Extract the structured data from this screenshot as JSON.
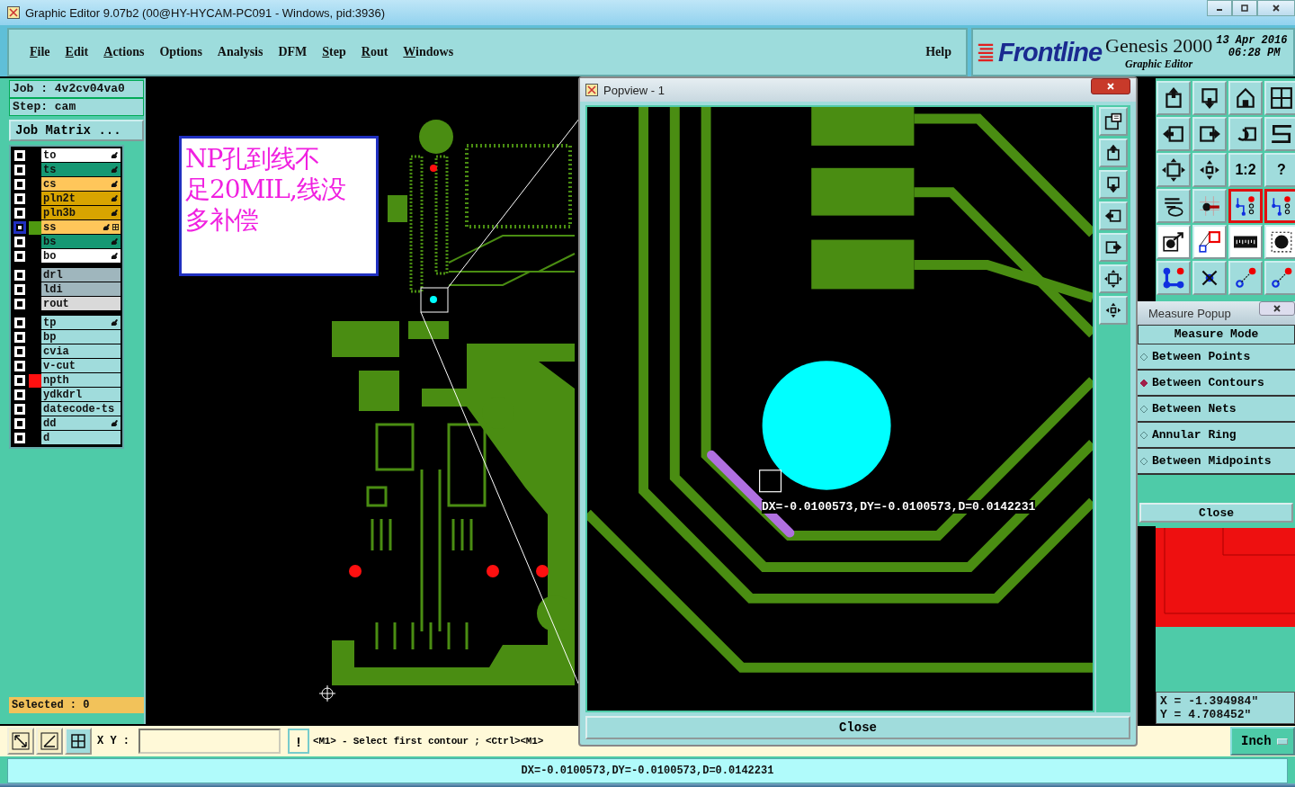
{
  "window": {
    "title": "Graphic Editor 9.07b2 (00@HY-HYCAM-PC091 - Windows, pid:3936)"
  },
  "menu": [
    {
      "label": "File",
      "mnemonic": true
    },
    {
      "label": "Edit",
      "mnemonic": true
    },
    {
      "label": "Actions",
      "mnemonic": true
    },
    {
      "label": "Options",
      "mnemonic": false
    },
    {
      "label": "Analysis",
      "mnemonic": false
    },
    {
      "label": "DFM",
      "mnemonic": false
    },
    {
      "label": "Step",
      "mnemonic": true
    },
    {
      "label": "Rout",
      "mnemonic": true
    },
    {
      "label": "Windows",
      "mnemonic": true
    }
  ],
  "help": "Help",
  "brand": {
    "logo": "Frontline",
    "product": "Genesis 2000",
    "subtitle": "Graphic Editor",
    "date": "13 Apr 2016",
    "time": "06:28 PM"
  },
  "job": "Job : 4v2cv04va0",
  "step": "Step: cam",
  "job_matrix": "Job Matrix ...",
  "layer_groups": [
    [
      {
        "name": "to",
        "kind": "paste",
        "affected": true,
        "selected": false,
        "attributes": false
      },
      {
        "name": "ts",
        "kind": "mask",
        "affected": true,
        "selected": false,
        "attributes": false
      },
      {
        "name": "cs",
        "kind": "signal",
        "affected": true,
        "selected": false,
        "attributes": false
      },
      {
        "name": "pln2t",
        "kind": "plane",
        "affected": true,
        "selected": false,
        "attributes": false
      },
      {
        "name": "pln3b",
        "kind": "plane",
        "affected": true,
        "selected": false,
        "attributes": false
      },
      {
        "name": "ss",
        "kind": "signal",
        "affected": true,
        "selected": true,
        "attributes": true,
        "color": "#4f9a10"
      },
      {
        "name": "bs",
        "kind": "mask",
        "affected": true,
        "selected": false,
        "attributes": false
      },
      {
        "name": "bo",
        "kind": "paste",
        "affected": true,
        "selected": false,
        "attributes": false
      }
    ],
    [
      {
        "name": "drl",
        "kind": "drill",
        "affected": false,
        "selected": false,
        "attributes": false
      },
      {
        "name": "ldi",
        "kind": "drill",
        "affected": false,
        "selected": false,
        "attributes": false
      },
      {
        "name": "rout",
        "kind": "rout",
        "affected": false,
        "selected": false,
        "attributes": false
      }
    ],
    [
      {
        "name": "tp",
        "kind": "document",
        "affected": true,
        "selected": false,
        "attributes": false
      },
      {
        "name": "bp",
        "kind": "document",
        "affected": false,
        "selected": false,
        "attributes": false
      },
      {
        "name": "cvia",
        "kind": "document",
        "affected": false,
        "selected": false,
        "attributes": false
      },
      {
        "name": "v-cut",
        "kind": "document",
        "affected": false,
        "selected": false,
        "attributes": false
      },
      {
        "name": "npth",
        "kind": "document",
        "affected": false,
        "selected": false,
        "attributes": false,
        "color": "#ff1010"
      },
      {
        "name": "ydkdrl",
        "kind": "document",
        "affected": false,
        "selected": false,
        "attributes": false
      },
      {
        "name": "datecode-ts",
        "kind": "document",
        "affected": false,
        "selected": false,
        "attributes": false
      },
      {
        "name": "dd",
        "kind": "document",
        "affected": true,
        "selected": false,
        "attributes": false
      },
      {
        "name": "d",
        "kind": "document",
        "affected": false,
        "selected": false,
        "attributes": false
      }
    ]
  ],
  "selected_count": "Selected : 0",
  "note": [
    "NP孔到线不",
    "足20MIL,线没",
    "多补偿"
  ],
  "popview": {
    "title": "Popview - 1",
    "readout": "DX=-0.0100573,DY=-0.0100573,D=0.0142231",
    "close": "Close",
    "tools": [
      {
        "kind": "zoom"
      },
      {
        "kind": "up"
      },
      {
        "kind": "down"
      },
      {
        "kind": "left"
      },
      {
        "kind": "right"
      },
      {
        "kind": "fit"
      },
      {
        "kind": "center"
      }
    ]
  },
  "tools": [
    {
      "kind": "up",
      "selected": false
    },
    {
      "kind": "down",
      "selected": false
    },
    {
      "kind": "home",
      "selected": false
    },
    {
      "kind": "grid",
      "selected": false
    },
    {
      "kind": "left",
      "selected": false
    },
    {
      "kind": "right",
      "selected": false
    },
    {
      "kind": "undo",
      "selected": false
    },
    {
      "kind": "snake",
      "selected": false
    },
    {
      "kind": "fit",
      "selected": false
    },
    {
      "kind": "center",
      "selected": false
    },
    {
      "kind": "text",
      "label": "1:2",
      "selected": false
    },
    {
      "kind": "text",
      "label": "?",
      "selected": false
    },
    {
      "kind": "tools",
      "selected": false
    },
    {
      "kind": "probe",
      "selected": false
    },
    {
      "kind": "net",
      "selected": true
    },
    {
      "kind": "net",
      "selected": true
    },
    {
      "kind": "measure",
      "selected": false
    },
    {
      "kind": "compare",
      "selected": false
    },
    {
      "kind": "ruler",
      "selected": false
    },
    {
      "kind": "pad",
      "selected": false
    },
    {
      "kind": "connect",
      "selected": false
    },
    {
      "kind": "cross",
      "selected": false
    },
    {
      "kind": "point",
      "selected": false
    },
    {
      "kind": "point",
      "selected": false
    }
  ],
  "measure_popup": {
    "title": "Measure Popup",
    "heading": "Measure Mode",
    "close": "Close",
    "modes": [
      {
        "label": "Between Points",
        "selected": false
      },
      {
        "label": "Between Contours",
        "selected": true
      },
      {
        "label": "Between Nets",
        "selected": false
      },
      {
        "label": "Annular Ring",
        "selected": false
      },
      {
        "label": "Between Midpoints",
        "selected": false
      }
    ]
  },
  "coords": [
    "X = -1.394984\"",
    "Y = 4.708452\""
  ],
  "bottom": {
    "xy_label": "X Y :",
    "bang": "!",
    "prompt": "<M1> - Select first contour ; <Ctrl><M1>",
    "units": "Inch"
  },
  "status": "DX=-0.0100573,DY=-0.0100573,D=0.0142231"
}
